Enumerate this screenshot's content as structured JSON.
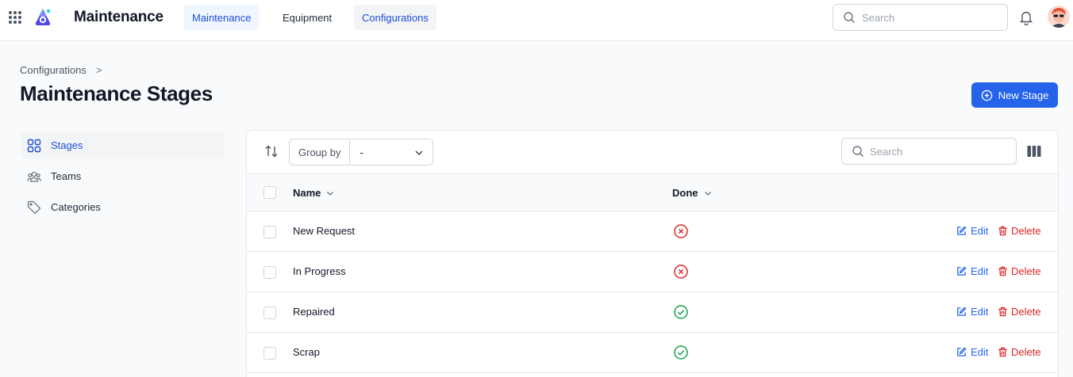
{
  "app": {
    "title": "Maintenance"
  },
  "nav": {
    "tabs": [
      {
        "label": "Maintenance"
      },
      {
        "label": "Equipment"
      },
      {
        "label": "Configurations"
      }
    ]
  },
  "top_search": {
    "placeholder": "Search"
  },
  "breadcrumb": {
    "parent": "Configurations",
    "separator": ">"
  },
  "page": {
    "title": "Maintenance Stages",
    "new_button_label": "New Stage"
  },
  "sidebar": {
    "items": [
      {
        "label": "Stages",
        "icon": "grid-icon",
        "active": true
      },
      {
        "label": "Teams",
        "icon": "users-icon",
        "active": false
      },
      {
        "label": "Categories",
        "icon": "tag-icon",
        "active": false
      }
    ]
  },
  "toolbar": {
    "group_by_label": "Group by",
    "group_by_value": "-",
    "search_placeholder": "Search"
  },
  "table": {
    "columns": [
      {
        "label": "Name"
      },
      {
        "label": "Done"
      }
    ],
    "rows": [
      {
        "name": "New Request",
        "done": false
      },
      {
        "name": "In Progress",
        "done": false
      },
      {
        "name": "Repaired",
        "done": true
      },
      {
        "name": "Scrap",
        "done": true
      }
    ],
    "edit_label": "Edit",
    "delete_label": "Delete"
  },
  "colors": {
    "accent": "#2563eb",
    "danger": "#dc2626",
    "success": "#16a34a"
  }
}
